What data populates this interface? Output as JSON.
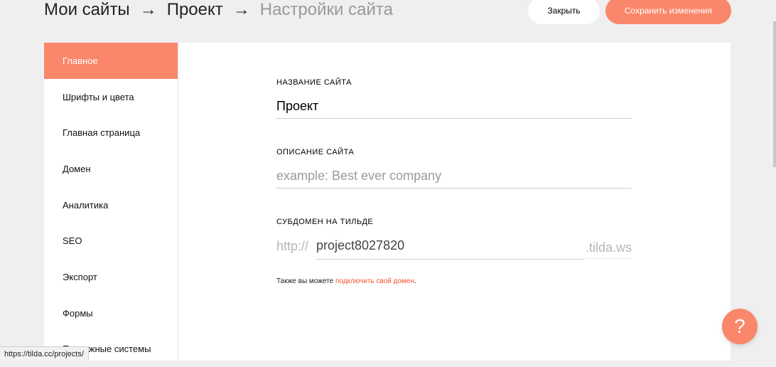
{
  "breadcrumb": {
    "my_sites": "Мои сайты",
    "separator": "→",
    "project": "Проект",
    "current": "Настройки сайта"
  },
  "header": {
    "close_label": "Закрыть",
    "save_label": "Сохранить изменения"
  },
  "sidebar": {
    "items": [
      {
        "label": "Главное",
        "active": true
      },
      {
        "label": "Шрифты и цвета"
      },
      {
        "label": "Главная страница"
      },
      {
        "label": "Домен"
      },
      {
        "label": "Аналитика"
      },
      {
        "label": "SEO"
      },
      {
        "label": "Экспорт"
      },
      {
        "label": "Формы"
      },
      {
        "label": "Платежные системы"
      }
    ]
  },
  "form": {
    "site_name_label": "НАЗВАНИЕ САЙТА",
    "site_name_value": "Проект",
    "site_description_label": "ОПИСАНИЕ САЙТА",
    "site_description_placeholder": "example: Best ever company",
    "subdomain_label": "СУБДОМЕН НА ТИЛЬДЕ",
    "subdomain_prefix": "http://",
    "subdomain_value": "project8027820",
    "subdomain_suffix": ".tilda.ws",
    "hint_text": "Также вы можете ",
    "hint_link": "подключить свой домен",
    "hint_end": "."
  },
  "help": {
    "glyph": "?"
  },
  "status_bar": {
    "url": "https://tilda.cc/projects/"
  },
  "colors": {
    "accent": "#fa876b",
    "link": "#f4542c",
    "background": "#efefef"
  }
}
